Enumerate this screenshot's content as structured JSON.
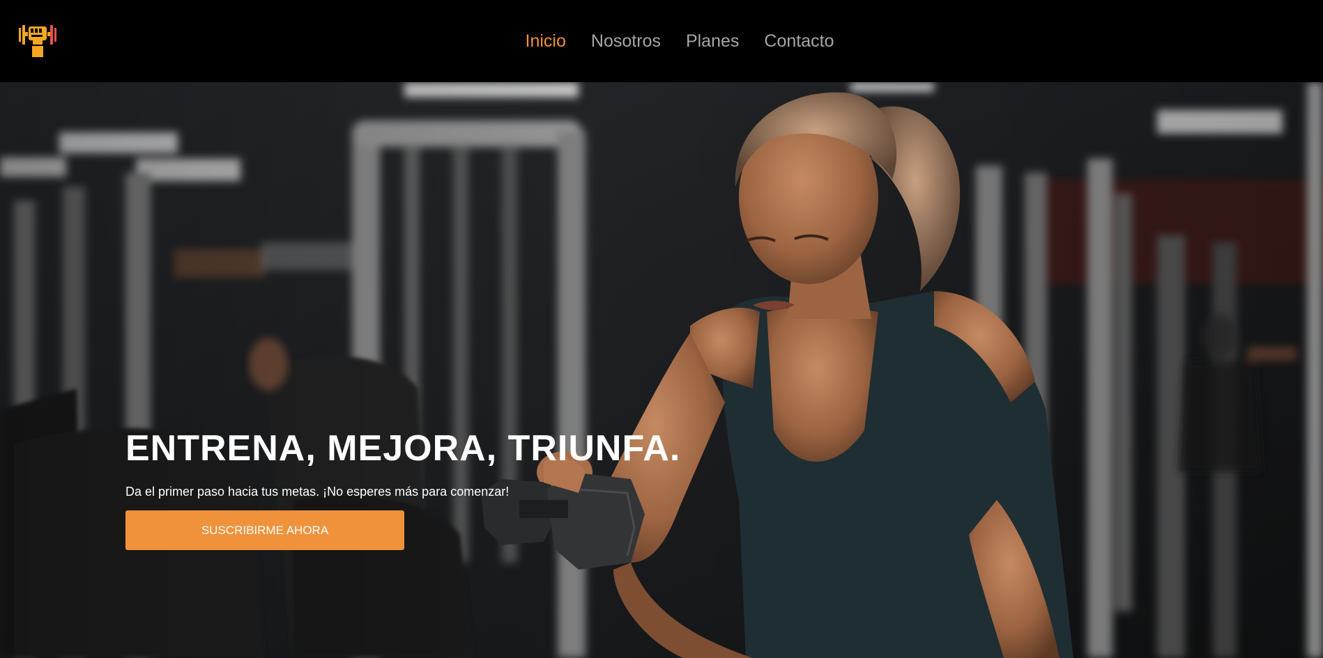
{
  "brand": {
    "logo_icon": "dumbbell-fist-icon",
    "accent_color": "#f0923b"
  },
  "nav": {
    "items": [
      {
        "label": "Inicio",
        "active": true
      },
      {
        "label": "Nosotros",
        "active": false
      },
      {
        "label": "Planes",
        "active": false
      },
      {
        "label": "Contacto",
        "active": false
      }
    ]
  },
  "hero": {
    "title": "ENTRENA, MEJORA, TRIUNFA.",
    "subtitle": "Da el primer paso hacia tus metas. ¡No esperes más para comenzar!",
    "cta_label": "SUSCRIBIRME AHORA",
    "background_image": "gym-woman-dumbbell-photo"
  }
}
